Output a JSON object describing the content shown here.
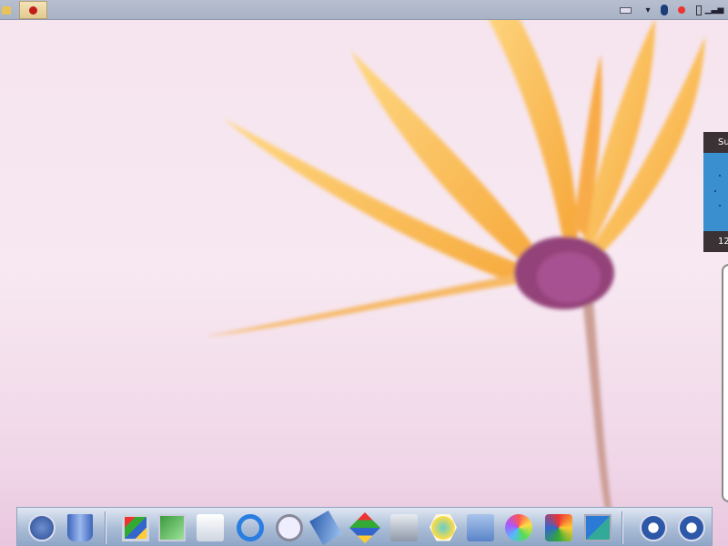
{
  "taskbar": {
    "apps": [
      {
        "icon": "folder-icon"
      },
      {
        "icon": "ladybug-icon",
        "active": true
      }
    ],
    "tray": [
      {
        "icon": "keyboard-icon"
      },
      {
        "icon": "chevron-down-icon"
      },
      {
        "icon": "bluetooth-icon"
      },
      {
        "icon": "network-error-icon"
      },
      {
        "icon": "battery-icon"
      },
      {
        "icon": "signal-icon"
      }
    ]
  },
  "widget": {
    "header": "Su",
    "footer": "12",
    "color": "#3a8fce"
  },
  "dock": {
    "items": [
      {
        "icon": "key-icon"
      },
      {
        "icon": "trash-icon"
      },
      {
        "icon": "my-computer-icon"
      },
      {
        "icon": "network-icon"
      },
      {
        "icon": "mail-icon"
      },
      {
        "icon": "internet-explorer-icon"
      },
      {
        "icon": "search-icon"
      },
      {
        "icon": "book-icon"
      },
      {
        "icon": "windows-icon"
      },
      {
        "icon": "hard-drive-icon"
      },
      {
        "icon": "settings-icon"
      },
      {
        "icon": "recent-folder-icon"
      },
      {
        "icon": "dvd-icon"
      },
      {
        "icon": "media-player-icon"
      },
      {
        "icon": "paint-icon"
      },
      {
        "icon": "logoff-icon"
      },
      {
        "icon": "power-icon"
      }
    ]
  }
}
